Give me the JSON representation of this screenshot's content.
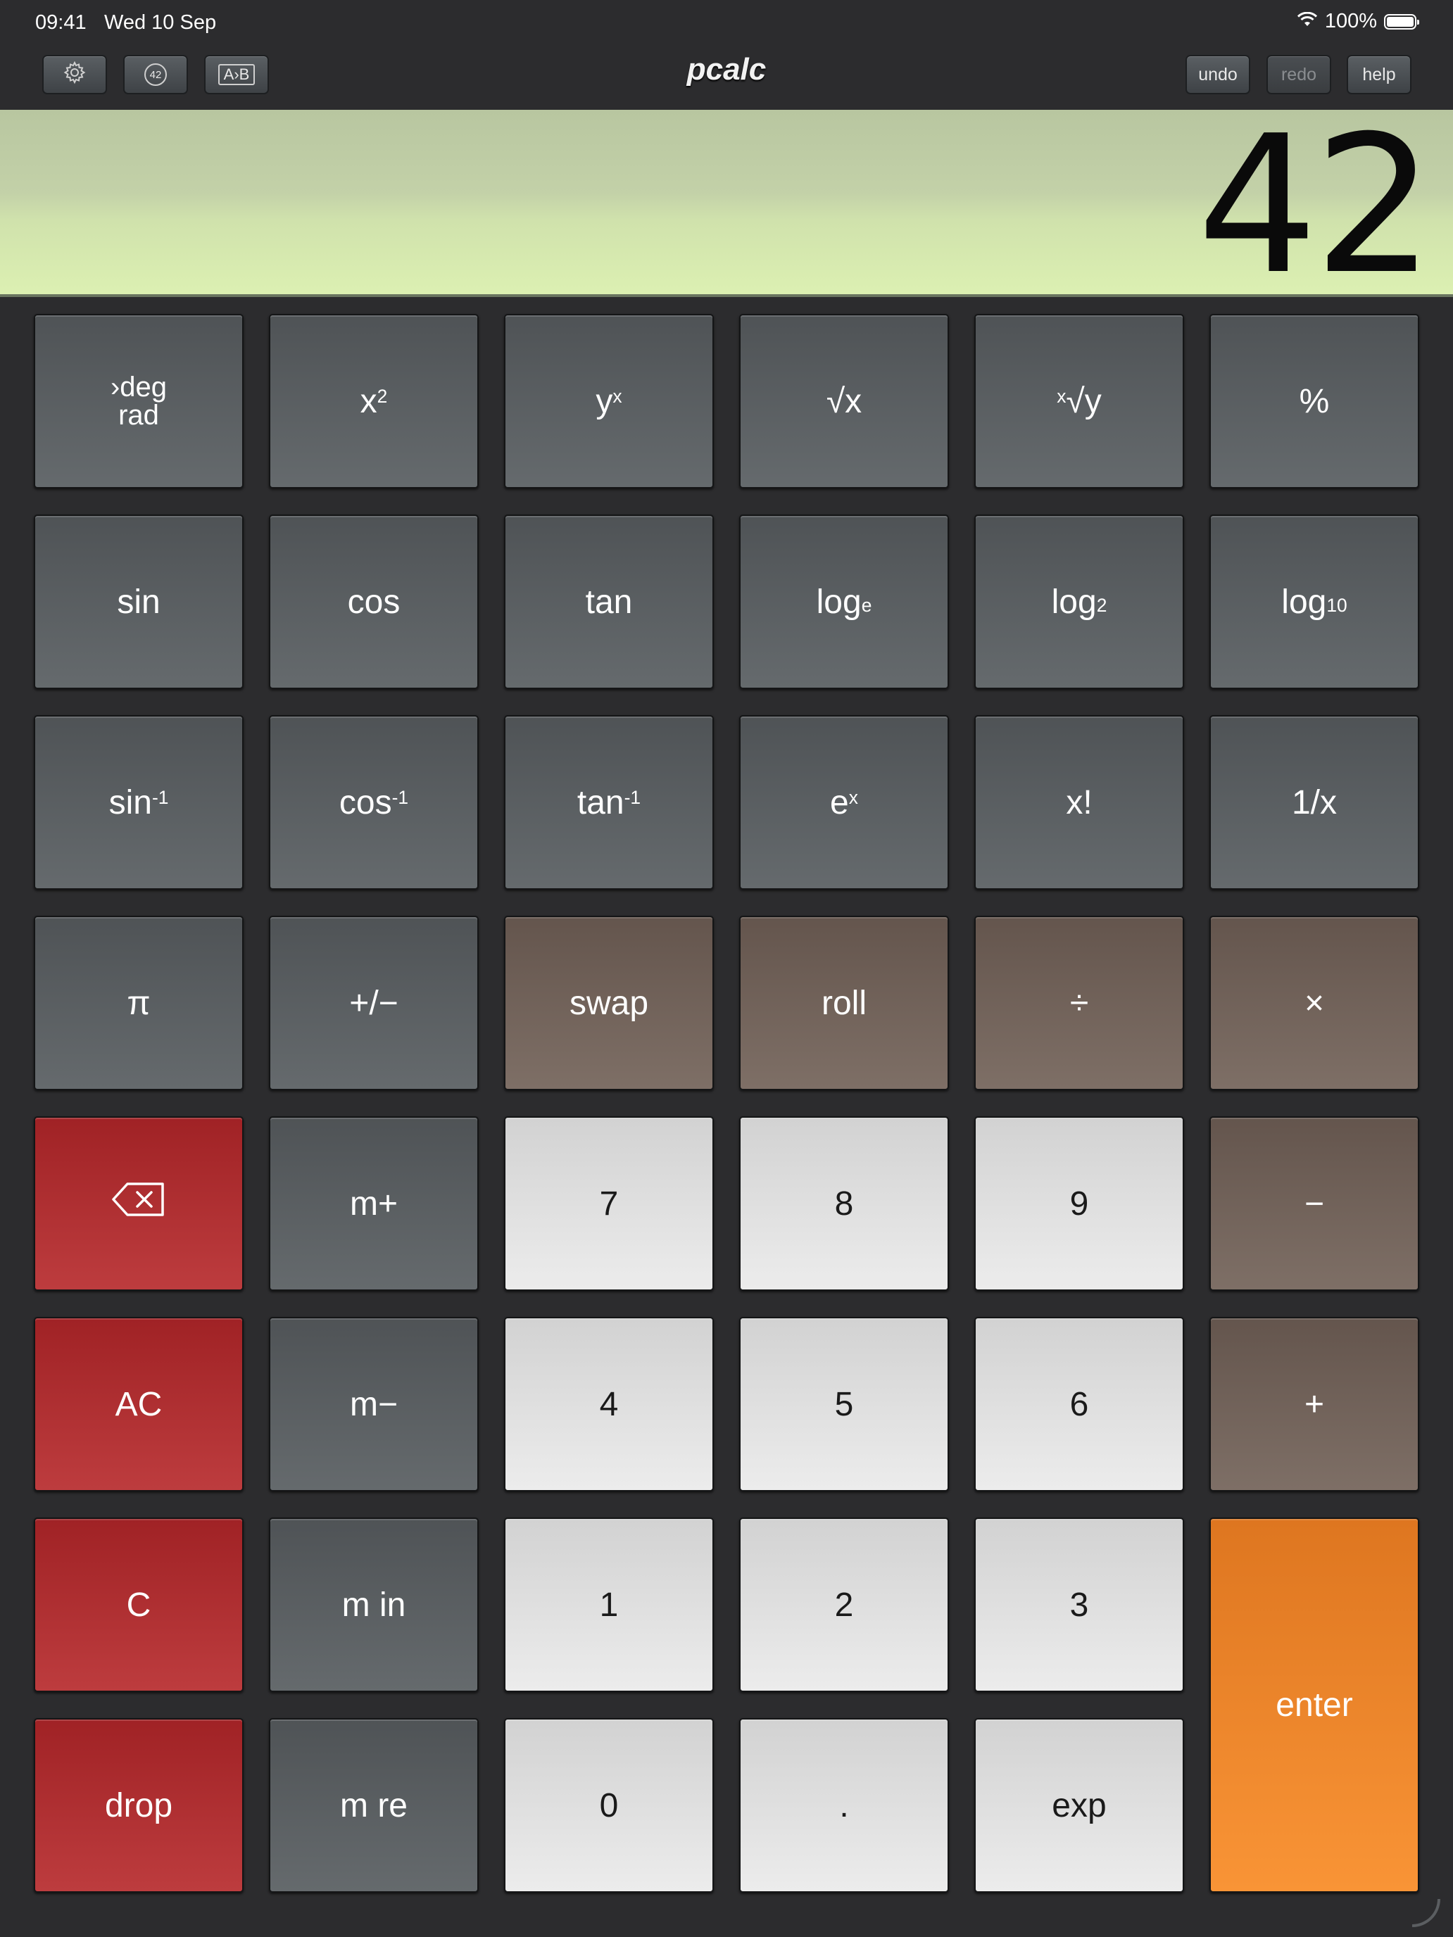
{
  "status_bar": {
    "time": "09:41",
    "date": "Wed 10 Sep",
    "battery": "100%"
  },
  "toolbar": {
    "settings_icon": "gear-icon",
    "stack_badge": "42",
    "format_label": "A›B",
    "title": "pcalc",
    "undo": "undo",
    "redo": "redo",
    "help": "help"
  },
  "display": {
    "value": "42"
  },
  "keys": {
    "deg_rad_top": "›deg",
    "deg_rad_bottom": "rad",
    "x_squared_base": "x",
    "x_squared_exp": "2",
    "y_pow_x_base": "y",
    "y_pow_x_exp": "x",
    "sqrt": "√x",
    "xroot_index": "x",
    "xroot_body": "√y",
    "percent": "%",
    "sin": "sin",
    "cos": "cos",
    "tan": "tan",
    "log_e_base": "log",
    "log_e_sub": "e",
    "log_2_base": "log",
    "log_2_sub": "2",
    "log_10_base": "log",
    "log_10_sub": "10",
    "asin_base": "sin",
    "asin_exp": "-1",
    "acos_base": "cos",
    "acos_exp": "-1",
    "atan_base": "tan",
    "atan_exp": "-1",
    "exp_e_base": "e",
    "exp_e_exp": "x",
    "factorial": "x!",
    "reciprocal": "1/x",
    "pi": "π",
    "plus_minus": "+/−",
    "swap": "swap",
    "roll": "roll",
    "divide": "÷",
    "multiply": "×",
    "backspace_icon": "backspace-icon",
    "m_plus": "m+",
    "seven": "7",
    "eight": "8",
    "nine": "9",
    "minus": "−",
    "ac": "AC",
    "m_minus": "m−",
    "four": "4",
    "five": "5",
    "six": "6",
    "plus": "+",
    "c": "C",
    "m_in": "m in",
    "one": "1",
    "two": "2",
    "three": "3",
    "enter": "enter",
    "drop": "drop",
    "m_re": "m re",
    "zero": "0",
    "dot": ".",
    "exp": "exp"
  },
  "colors": {
    "display_bg": "#d0e2ac",
    "function_key": "#5a5f63",
    "operator_key": "#75665d",
    "clear_key": "#b02f31",
    "digit_key": "#e0e0e0",
    "enter_key": "#f08a2e"
  }
}
